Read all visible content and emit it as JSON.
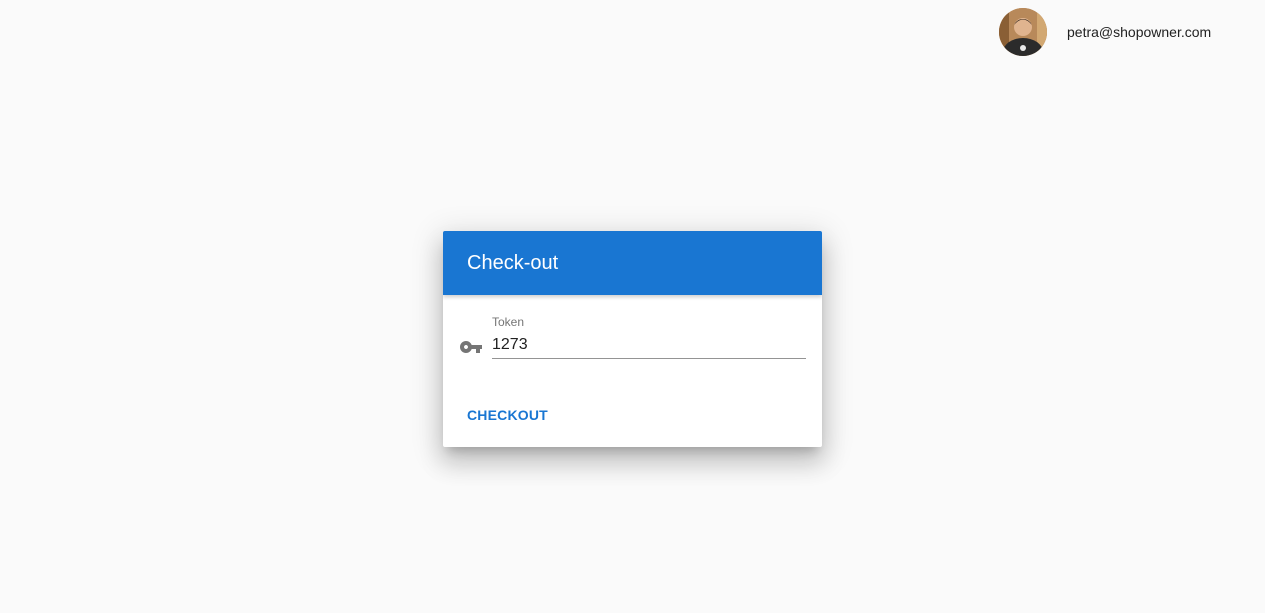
{
  "header": {
    "user_email": "petra@shopowner.com",
    "avatar_icon": "user-avatar"
  },
  "dialog": {
    "title": "Check-out",
    "header_color": "#1976d2",
    "token_field": {
      "label": "Token",
      "value": "1273",
      "icon": "key-icon"
    },
    "actions": {
      "checkout_label": "CHECKOUT"
    }
  }
}
